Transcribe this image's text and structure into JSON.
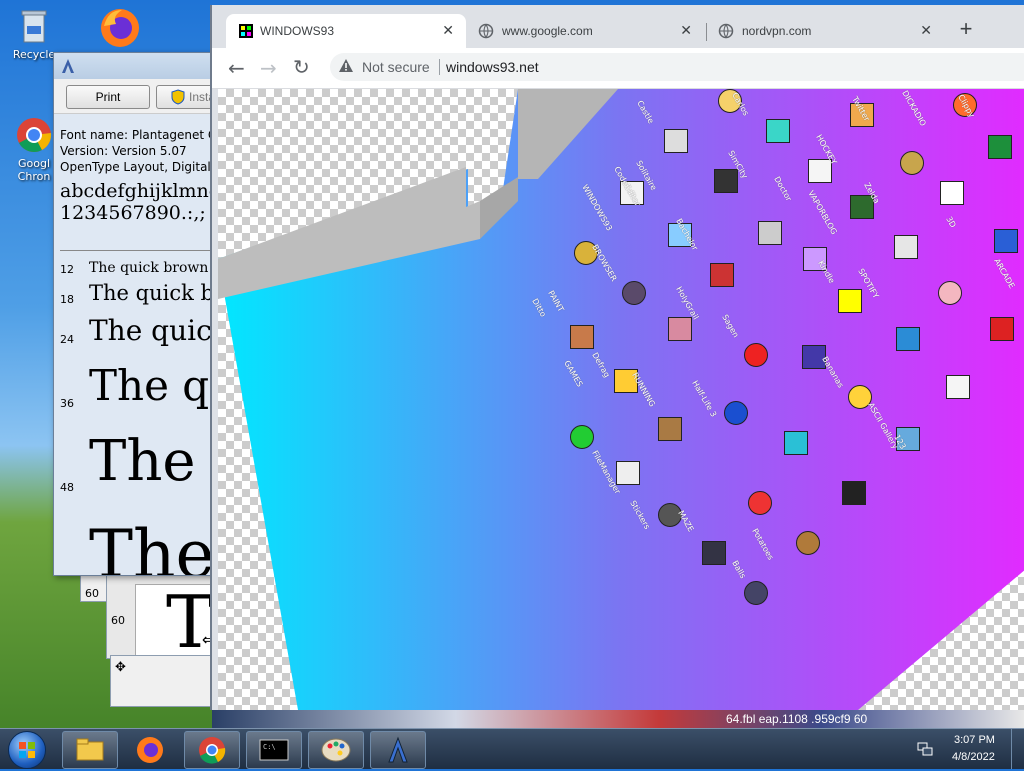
{
  "desktop": {
    "icons": [
      {
        "label": "Recycle",
        "icon": "recycle-bin-icon"
      },
      {
        "label": "Googl",
        "label2": "Chron",
        "icon": "chrome-icon"
      },
      {
        "label": "",
        "icon": "firefox-shortcut-icon"
      }
    ],
    "stack_numbers": [
      "60",
      "60"
    ]
  },
  "font_viewer": {
    "print_label": "Print",
    "install_label": "Insta",
    "font_name": "Font name: Plantagenet C",
    "version": "Version: Version 5.07",
    "layout": "OpenType Layout, Digitall",
    "alphabet": "abcdefghijklmno",
    "digits": "1234567890.:,; ' \"",
    "sizes": [
      {
        "num": "12",
        "text": "The quick brown"
      },
      {
        "num": "18",
        "text": "The quick b"
      },
      {
        "num": "24",
        "text": "The quic"
      },
      {
        "num": "36",
        "text": "The q"
      },
      {
        "num": "48",
        "text": "The"
      },
      {
        "num": "",
        "text": "The"
      }
    ],
    "preview_char": "T"
  },
  "browser": {
    "tabs": [
      {
        "label": "WINDOWS93",
        "icon": "windows93-favicon-icon",
        "active": true
      },
      {
        "label": "www.google.com",
        "icon": "globe-icon",
        "active": false
      },
      {
        "label": "nordvpn.com",
        "icon": "globe-icon",
        "active": false
      }
    ],
    "new_tab": "+",
    "security": "Not secure",
    "url": "windows93.net"
  },
  "viewport": {
    "labels": [
      "Castle",
      "Carlos",
      "DICKADIO",
      "Twitter",
      "WINDOWS93",
      "Solitaire",
      "SimCity",
      "HOCKEY",
      "3D",
      "Clippy",
      "Doctor",
      "Zelda",
      "VAPORBLOG",
      "Kindle",
      "CodeEditor",
      "Bachelor",
      "PAINT",
      "BROWSER",
      "SPOTIFY",
      "ARCADE",
      "HolyGrail",
      "Sagen",
      "Ditto",
      "GAMES",
      "Defrag",
      "RUNNING",
      "Half-Life 3",
      "FileManager",
      "MAZE",
      "Potatoes",
      "Bananas",
      "ASCII Gallery",
      "123",
      "Stickers",
      "Balls"
    ],
    "background": [
      "#00e5ff",
      "#8a6cf0",
      "#d633ff"
    ]
  },
  "taskbar": {
    "items": [
      "start-orb-icon",
      "file-explorer-icon",
      "firefox-icon",
      "chrome-icon",
      "command-prompt-icon",
      "paint-icon",
      "font-viewer-icon"
    ],
    "time": "3:07 PM",
    "date": "4/8/2022",
    "behind_text": "64.fbl   eap.1108   .959cf9   60"
  }
}
